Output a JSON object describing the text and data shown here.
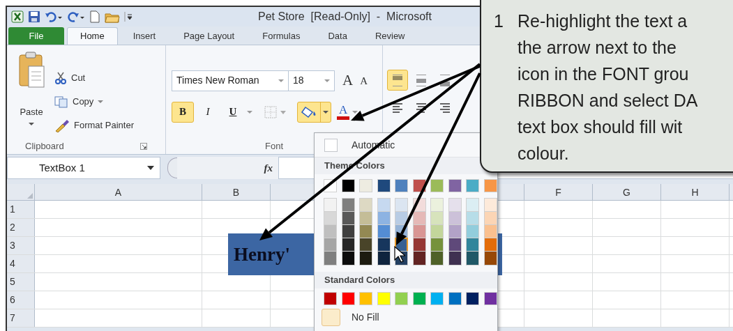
{
  "window": {
    "title": "Pet Store  [Read-Only]  -  Microsoft"
  },
  "ribbon_tabs": [
    {
      "label": "File",
      "kind": "file",
      "selected": false
    },
    {
      "label": "Home",
      "kind": "tab",
      "selected": true
    },
    {
      "label": "Insert",
      "kind": "tab",
      "selected": false
    },
    {
      "label": "Page Layout",
      "kind": "tab",
      "selected": false
    },
    {
      "label": "Formulas",
      "kind": "tab",
      "selected": false
    },
    {
      "label": "Data",
      "kind": "tab",
      "selected": false
    },
    {
      "label": "Review",
      "kind": "tab",
      "selected": false
    }
  ],
  "clipboard_group": {
    "paste": "Paste",
    "cut": "Cut",
    "copy": "Copy",
    "format_painter": "Format Painter",
    "label": "Clipboard"
  },
  "font_group": {
    "font_name": "Times New Roman",
    "font_size": "18",
    "grow": "A",
    "shrink": "A",
    "font_color": "A",
    "label": "Font",
    "fill_menu_open": true,
    "styles": [
      {
        "label": "B",
        "kind": "bold",
        "selected": true
      },
      {
        "label": "I",
        "kind": "italic",
        "selected": false
      },
      {
        "label": "U",
        "kind": "underline",
        "selected": false
      }
    ]
  },
  "alignment": [
    {
      "selected": true
    },
    {
      "selected": false
    },
    {
      "selected": false
    }
  ],
  "name_box": "TextBox 1",
  "formula_label": "fx",
  "columns_left": [
    "A",
    "B"
  ],
  "columns_right": [
    "F",
    "G",
    "H"
  ],
  "rows": [
    "1",
    "2",
    "3",
    "4",
    "5",
    "6",
    "7"
  ],
  "text_box": {
    "text": "Henry'"
  },
  "fill_menu": {
    "automatic": "Automatic",
    "theme_label": "Theme Colors",
    "standard_label": "Standard Colors",
    "no_fill": "No Fill",
    "theme_colors": [
      {
        "color": "#ffffff",
        "selected": false,
        "shades": [
          {
            "color": "#f2f2f2",
            "selected": false
          },
          {
            "color": "#d8d8d8",
            "selected": false
          },
          {
            "color": "#bfbfbf",
            "selected": false
          },
          {
            "color": "#a5a5a5",
            "selected": false
          },
          {
            "color": "#7f7f7f",
            "selected": false
          }
        ]
      },
      {
        "color": "#000000",
        "selected": false,
        "shades": [
          {
            "color": "#7f7f7f",
            "selected": false
          },
          {
            "color": "#595959",
            "selected": false
          },
          {
            "color": "#3f3f3f",
            "selected": false
          },
          {
            "color": "#262626",
            "selected": false
          },
          {
            "color": "#0c0c0c",
            "selected": false
          }
        ]
      },
      {
        "color": "#eeece1",
        "selected": false,
        "shades": [
          {
            "color": "#ddd9c3",
            "selected": false
          },
          {
            "color": "#c4bd97",
            "selected": false
          },
          {
            "color": "#938953",
            "selected": false
          },
          {
            "color": "#494429",
            "selected": false
          },
          {
            "color": "#1d1b10",
            "selected": false
          }
        ]
      },
      {
        "color": "#1f497d",
        "selected": false,
        "shades": [
          {
            "color": "#c6d9f0",
            "selected": false
          },
          {
            "color": "#8db3e2",
            "selected": false
          },
          {
            "color": "#548dd4",
            "selected": false
          },
          {
            "color": "#17365d",
            "selected": false
          },
          {
            "color": "#0f243e",
            "selected": false
          }
        ]
      },
      {
        "color": "#4f81bd",
        "selected": false,
        "shades": [
          {
            "color": "#dbe5f1",
            "selected": false
          },
          {
            "color": "#b8cce4",
            "selected": false
          },
          {
            "color": "#95b3d7",
            "selected": false
          },
          {
            "color": "#366092",
            "selected": true
          },
          {
            "color": "#244061",
            "selected": false
          }
        ]
      },
      {
        "color": "#c0504d",
        "selected": false,
        "shades": [
          {
            "color": "#f2dcdb",
            "selected": false
          },
          {
            "color": "#e5b9b7",
            "selected": false
          },
          {
            "color": "#d99694",
            "selected": false
          },
          {
            "color": "#953734",
            "selected": false
          },
          {
            "color": "#632423",
            "selected": false
          }
        ]
      },
      {
        "color": "#9bbb59",
        "selected": false,
        "shades": [
          {
            "color": "#ebf1dd",
            "selected": false
          },
          {
            "color": "#d7e3bc",
            "selected": false
          },
          {
            "color": "#c3d69b",
            "selected": false
          },
          {
            "color": "#76923c",
            "selected": false
          },
          {
            "color": "#4f6128",
            "selected": false
          }
        ]
      },
      {
        "color": "#8064a2",
        "selected": false,
        "shades": [
          {
            "color": "#e5e0ec",
            "selected": false
          },
          {
            "color": "#ccc1d9",
            "selected": false
          },
          {
            "color": "#b2a2c7",
            "selected": false
          },
          {
            "color": "#5f497a",
            "selected": false
          },
          {
            "color": "#3f3151",
            "selected": false
          }
        ]
      },
      {
        "color": "#4bacc6",
        "selected": false,
        "shades": [
          {
            "color": "#dbeef3",
            "selected": false
          },
          {
            "color": "#b7dde8",
            "selected": false
          },
          {
            "color": "#92cddc",
            "selected": false
          },
          {
            "color": "#31859b",
            "selected": false
          },
          {
            "color": "#205867",
            "selected": false
          }
        ]
      },
      {
        "color": "#f79646",
        "selected": false,
        "shades": [
          {
            "color": "#fdeada",
            "selected": false
          },
          {
            "color": "#fbd5b5",
            "selected": false
          },
          {
            "color": "#fac08f",
            "selected": false
          },
          {
            "color": "#e36c09",
            "selected": false
          },
          {
            "color": "#974806",
            "selected": false
          }
        ]
      }
    ],
    "standard_colors": [
      {
        "color": "#c00000",
        "selected": false
      },
      {
        "color": "#ff0000",
        "selected": false
      },
      {
        "color": "#ffc000",
        "selected": false
      },
      {
        "color": "#ffff00",
        "selected": false
      },
      {
        "color": "#92d050",
        "selected": false
      },
      {
        "color": "#00b050",
        "selected": false
      },
      {
        "color": "#00b0f0",
        "selected": false
      },
      {
        "color": "#0070c0",
        "selected": false
      },
      {
        "color": "#002060",
        "selected": false
      },
      {
        "color": "#7030a0",
        "selected": false
      }
    ]
  },
  "callout": {
    "step": "1",
    "lines": [
      "Re-highlight the text a",
      "the arrow next to the",
      "icon in the FONT grou",
      "RIBBON and select DA",
      "text box should fill wit",
      "colour."
    ]
  }
}
